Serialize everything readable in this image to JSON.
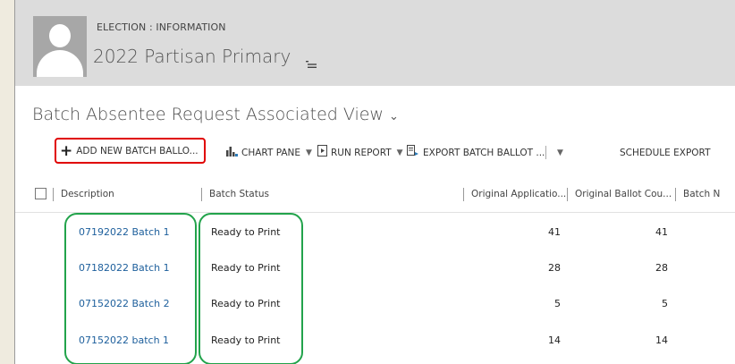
{
  "header": {
    "entity_label": "ELECTION : INFORMATION",
    "record_title": "2022 Partisan Primary"
  },
  "view": {
    "title": "Batch Absentee Request Associated View"
  },
  "toolbar": {
    "add_label": "ADD NEW BATCH BALLO...",
    "chart_label": "CHART PANE",
    "report_label": "RUN REPORT",
    "export_label": "EXPORT BATCH BALLOT ...",
    "schedule_label": "SCHEDULE EXPORT"
  },
  "grid": {
    "columns": [
      "Description",
      "Batch Status",
      "Original Applicatio...",
      "Original Ballot Cou...",
      "Batch N"
    ],
    "rows": [
      {
        "description": "07192022 Batch 1",
        "status": "Ready to Print",
        "applications": "41",
        "ballots": "41"
      },
      {
        "description": "07182022 Batch 1",
        "status": "Ready to Print",
        "applications": "28",
        "ballots": "28"
      },
      {
        "description": "07152022 Batch 2",
        "status": "Ready to Print",
        "applications": "5",
        "ballots": "5"
      },
      {
        "description": "07152022 batch 1",
        "status": "Ready to Print",
        "applications": "14",
        "ballots": "14"
      }
    ]
  },
  "colors": {
    "link": "#1d5f9c",
    "highlight_red": "#e00000",
    "highlight_green": "#22a34b",
    "header_bg": "#dcdcdc"
  }
}
